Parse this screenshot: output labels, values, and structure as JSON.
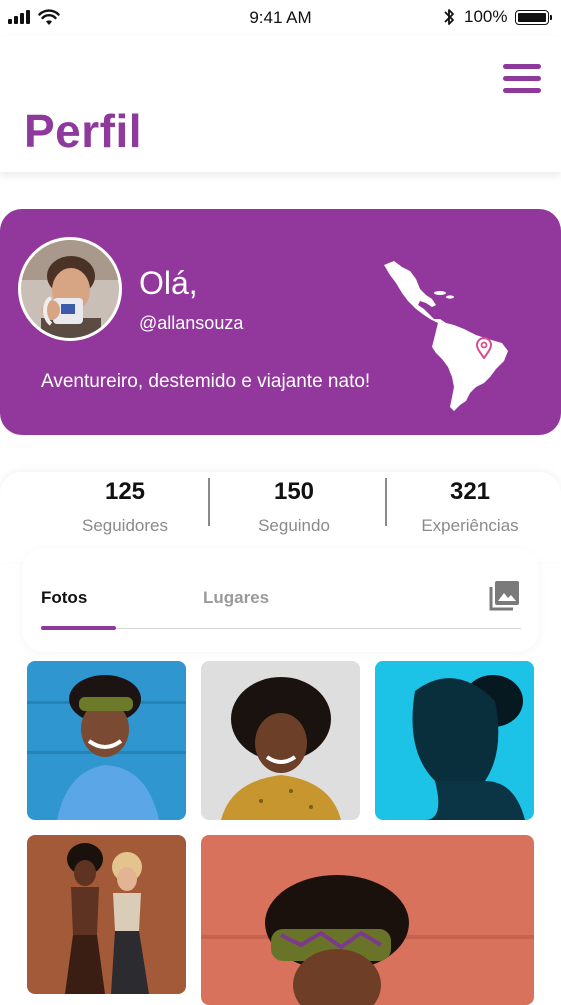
{
  "status_bar": {
    "time": "9:41 AM",
    "battery": "100%"
  },
  "header": {
    "title": "Perfil",
    "menu_icon": "hamburger-menu-icon"
  },
  "profile": {
    "greeting": "Olá,",
    "handle": "@allansouza",
    "bio": "Aventureiro, destemido e viajante nato!",
    "card_color": "#92379c",
    "map_icon": "latin-america-map-icon",
    "pin_icon": "location-pin-icon"
  },
  "stats": [
    {
      "value": "125",
      "label": "Seguidores"
    },
    {
      "value": "150",
      "label": "Seguindo"
    },
    {
      "value": "321",
      "label": "Experiências"
    }
  ],
  "tabs": [
    {
      "label": "Fotos",
      "active": true
    },
    {
      "label": "Lugares",
      "active": false
    }
  ],
  "gallery_icon": "photo-library-icon",
  "photos": [
    "woman-headwrap-blue-wall",
    "man-afro-yellow-shirt",
    "woman-blue-light-portrait",
    "two-women-dancing",
    "woman-headwrap-pink-wall"
  ],
  "accent_color": "#8e3a9d"
}
